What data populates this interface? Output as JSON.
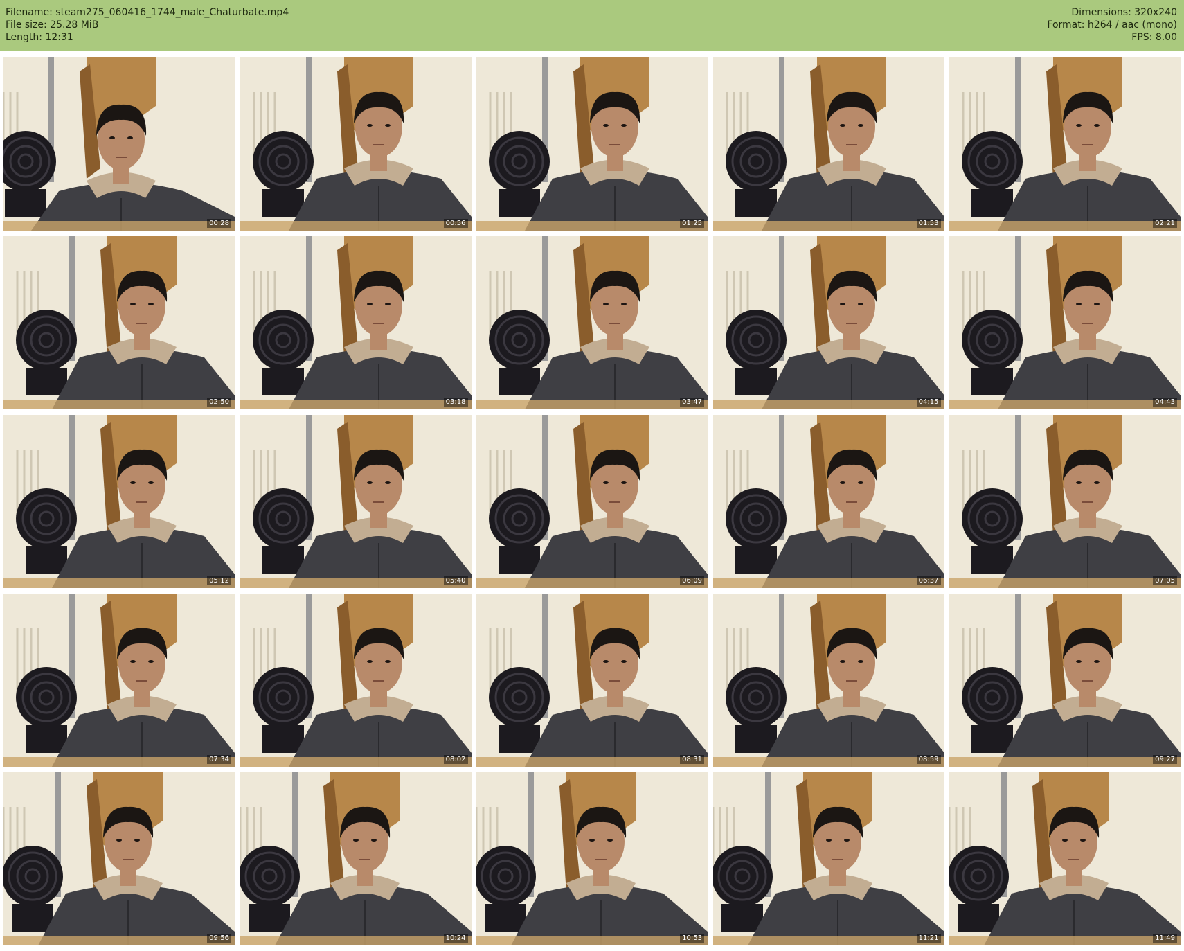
{
  "header": {
    "filename": "Filename: steam275_060416_1744_male_Chaturbate.mp4",
    "filesize": "File size: 25.28 MiB",
    "length": "Length: 12:31",
    "dimensions": "Dimensions: 320x240",
    "format": "Format: h264 / aac (mono)",
    "fps": "FPS: 8.00"
  },
  "thumbnails": [
    {
      "timestamp": "00:28"
    },
    {
      "timestamp": "00:56"
    },
    {
      "timestamp": "01:25"
    },
    {
      "timestamp": "01:53"
    },
    {
      "timestamp": "02:21"
    },
    {
      "timestamp": "02:50"
    },
    {
      "timestamp": "03:18"
    },
    {
      "timestamp": "03:47"
    },
    {
      "timestamp": "04:15"
    },
    {
      "timestamp": "04:43"
    },
    {
      "timestamp": "05:12"
    },
    {
      "timestamp": "05:40"
    },
    {
      "timestamp": "06:09"
    },
    {
      "timestamp": "06:37"
    },
    {
      "timestamp": "07:05"
    },
    {
      "timestamp": "07:34"
    },
    {
      "timestamp": "08:02"
    },
    {
      "timestamp": "08:31"
    },
    {
      "timestamp": "08:59"
    },
    {
      "timestamp": "09:27"
    },
    {
      "timestamp": "09:56"
    },
    {
      "timestamp": "10:24"
    },
    {
      "timestamp": "10:53"
    },
    {
      "timestamp": "11:21"
    },
    {
      "timestamp": "11:49"
    }
  ],
  "colors": {
    "header_bg": "#aac97e",
    "wall": "#e9e2cf",
    "cabinet": "#b7874a",
    "hoodie": "#3f3f44",
    "fan": "#1c1a1f",
    "skin": "#b88a6a",
    "hair": "#1b1613"
  }
}
